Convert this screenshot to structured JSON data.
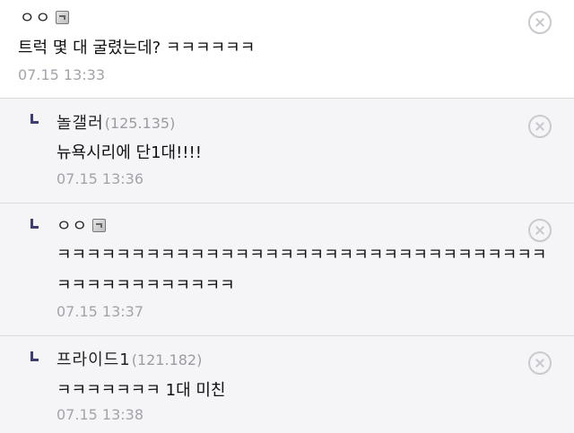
{
  "comments": [
    {
      "nickname": "ㅇㅇ",
      "ip": "",
      "text": "트럭 몇 대 굴렸는데? ㅋㅋㅋㅋㅋㅋ",
      "date": "07.15 13:33",
      "fixed_icon": "fixed-nick-icon",
      "delete_icon": "close-circle-icon"
    },
    {
      "nickname": "놀갤러",
      "ip": "(125.135)",
      "text": "뉴욕시리에 단1대!!!!",
      "date": "07.15 13:36",
      "reply_icon": "reply-arrow-icon",
      "delete_icon": "close-circle-icon"
    },
    {
      "nickname": "ㅇㅇ",
      "ip": "",
      "text": "ㅋㅋㅋㅋㅋㅋㅋㅋㅋㅋㅋㅋㅋㅋㅋㅋㅋㅋㅋㅋㅋㅋㅋㅋㅋㅋㅋㅋㅋㅋㅋㅋㅋㅋㅋㅋㅋㅋㅋㅋㅋㅋㅋㅋㅋ",
      "date": "07.15 13:37",
      "fixed_icon": "fixed-nick-icon",
      "reply_icon": "reply-arrow-icon",
      "delete_icon": "close-circle-icon"
    },
    {
      "nickname": "프라이드1",
      "ip": "(121.182)",
      "text": "ㅋㅋㅋㅋㅋㅋㅋ 1대 미친",
      "date": "07.15 13:38",
      "reply_icon": "reply-arrow-icon",
      "delete_icon": "close-circle-icon"
    }
  ]
}
